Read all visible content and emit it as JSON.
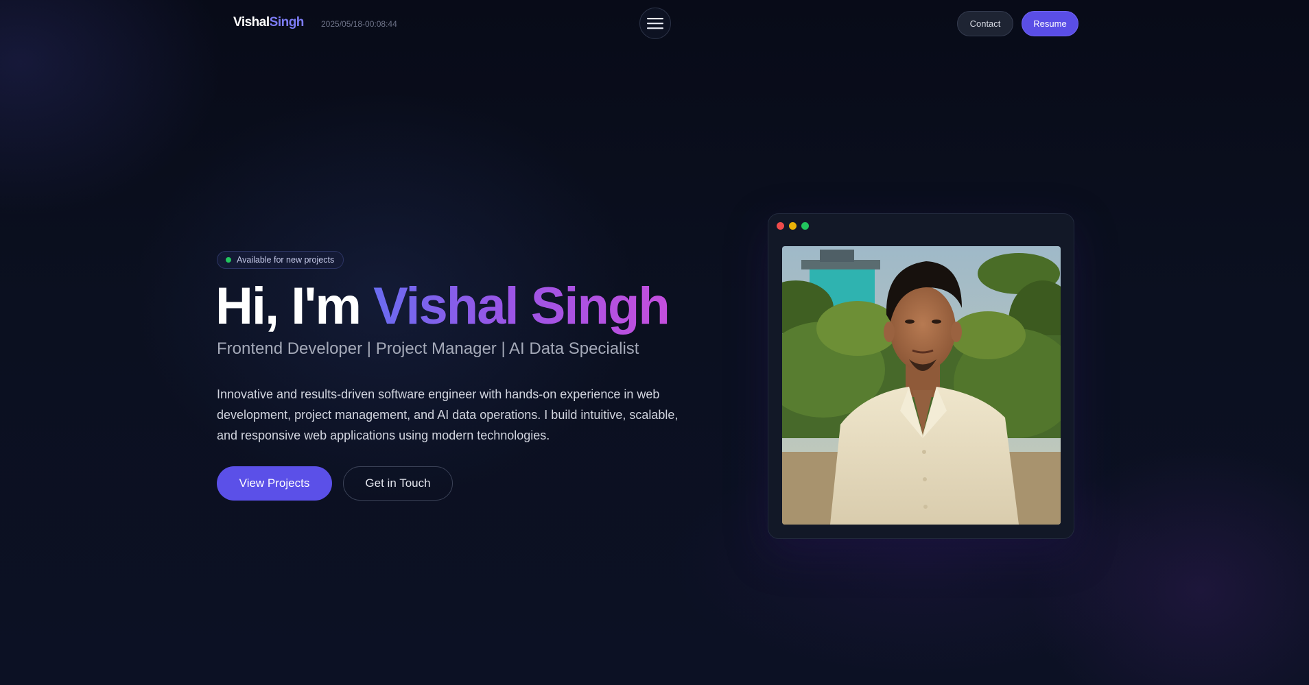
{
  "header": {
    "brand_first": "Vishal",
    "brand_last": "Singh",
    "timestamp": "2025/05/18-00:08:44",
    "menu_icon": "hamburger-menu-icon",
    "contact_label": "Contact",
    "resume_label": "Resume"
  },
  "hero": {
    "status_badge": "Available for new projects",
    "title_greeting": "Hi, I'm ",
    "title_name": "Vishal Singh",
    "subtitle": "Frontend Developer | Project Manager | AI Data Specialist",
    "description": "Innovative and results-driven software engineer with hands-on experience in web development, project management, and AI data operations. I build intuitive, scalable, and responsive web applications using modern technologies.",
    "primary_button": "View Projects",
    "secondary_button": "Get in Touch"
  },
  "photo_card": {
    "image_subject": "portrait photo of a young man in a cream short-sleeve shirt standing in front of palm trees and a building"
  },
  "colors": {
    "accent": "#5b50e8",
    "brand_last": "#7c7cf5",
    "gradient_start": "#6a6cf0",
    "gradient_end": "#c44fdd",
    "status_dot": "#22c55e",
    "background": "#0a0e1c"
  }
}
